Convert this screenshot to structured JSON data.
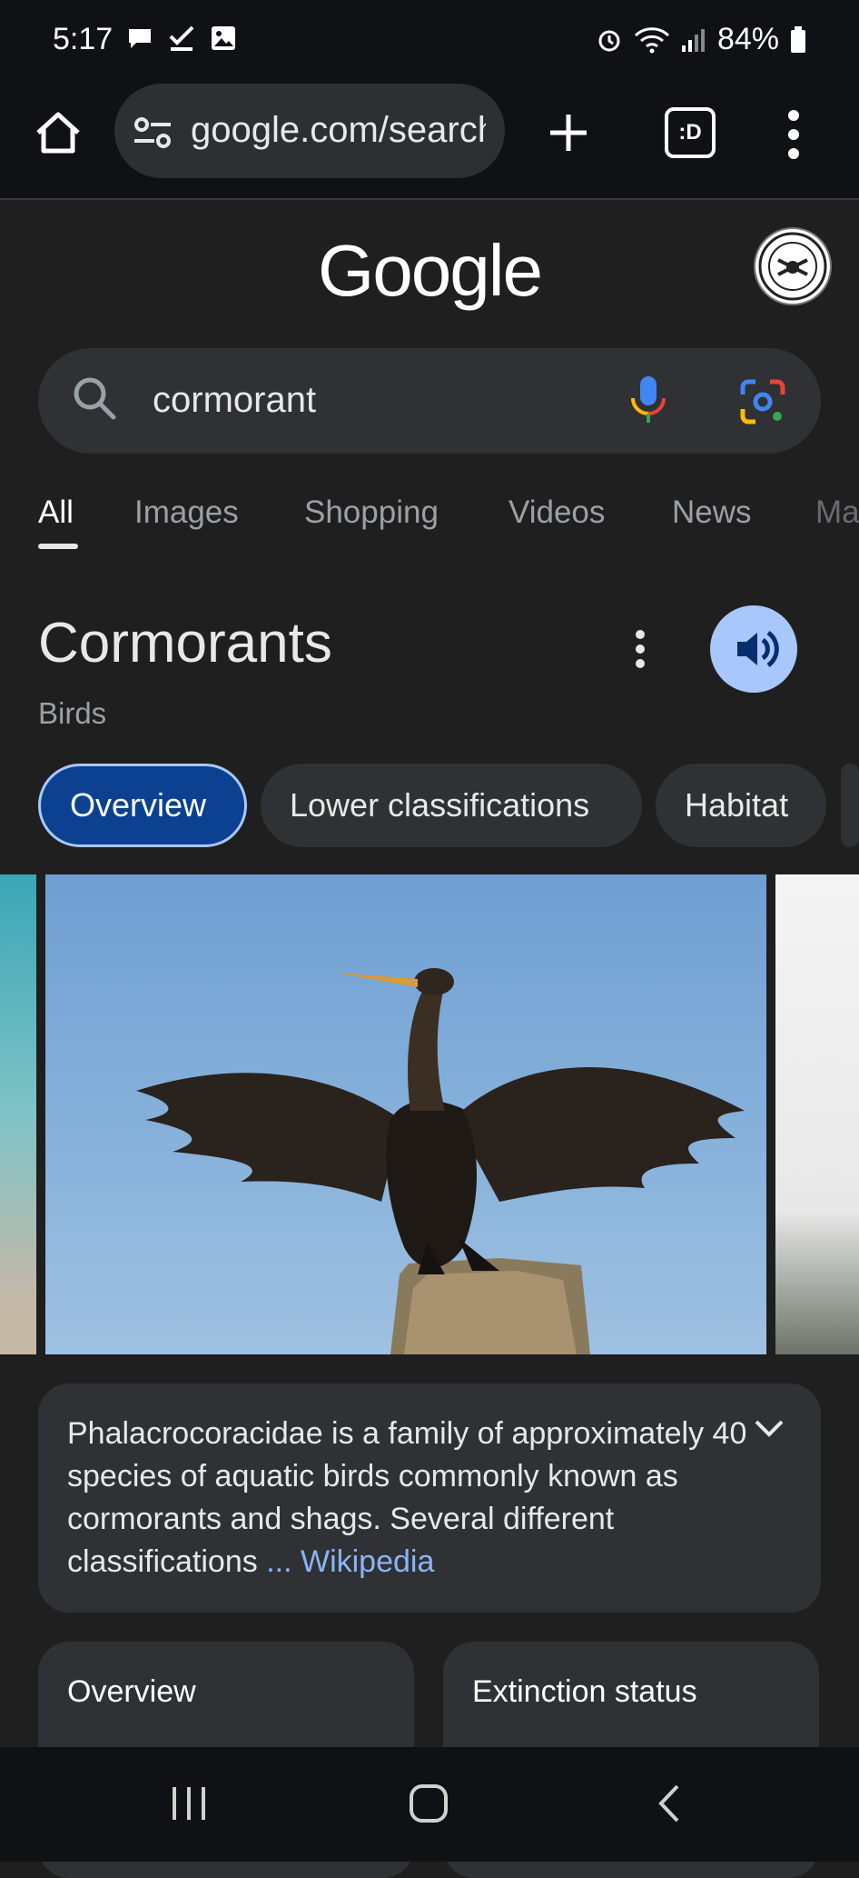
{
  "status_bar": {
    "time": "5:17",
    "battery": "84%"
  },
  "browser": {
    "url": "google.com/search",
    "tabs_label": ":D"
  },
  "google": {
    "logo": "Google",
    "search_query": "cormorant"
  },
  "search_tabs": [
    {
      "label": "All"
    },
    {
      "label": "Images"
    },
    {
      "label": "Shopping"
    },
    {
      "label": "Videos"
    },
    {
      "label": "News"
    },
    {
      "label": "Ma"
    }
  ],
  "knowledge_panel": {
    "title": "Cormorants",
    "subtitle": "Birds",
    "chips": [
      {
        "label": "Overview"
      },
      {
        "label": "Lower classifications"
      },
      {
        "label": "Habitat"
      }
    ],
    "description": "Phalacrocoracidae is a family of approximately 40 species of aquatic birds commonly known as cormorants and shags. Several different classifications ",
    "description_link": "... Wikipedia",
    "cards": [
      {
        "title": "Overview"
      },
      {
        "title": "Extinction status"
      }
    ]
  },
  "colors": {
    "accent_blue": "#a8c7fa",
    "chip_active_bg": "#0b4190",
    "link": "#8ab4f8"
  }
}
